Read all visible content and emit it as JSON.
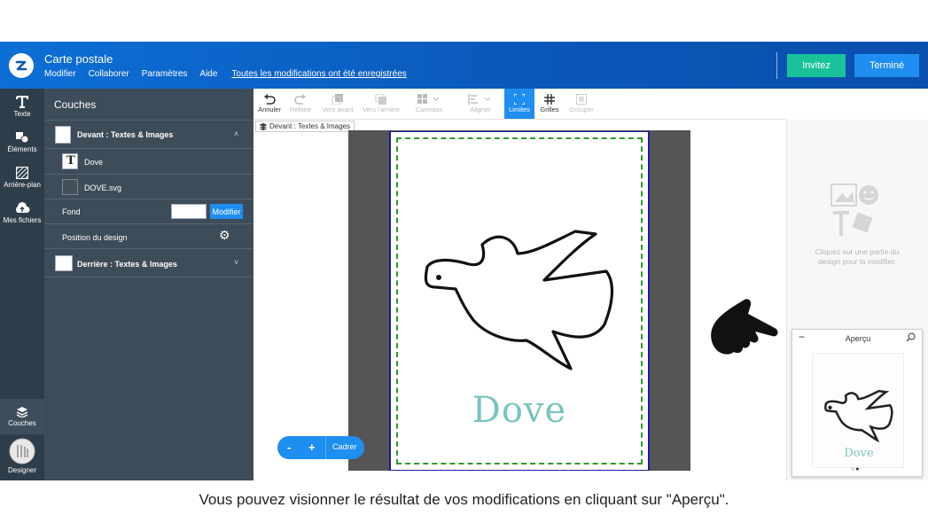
{
  "header": {
    "title": "Carte postale",
    "menu": [
      "Modifier",
      "Collaborer",
      "Paramètres",
      "Aide"
    ],
    "saved_status": "Toutes les modifications ont été enregistrées",
    "invite_label": "Invitez",
    "done_label": "Terminé"
  },
  "rail": {
    "items": [
      "Texte",
      "Éléments",
      "Arrière-plan",
      "Mes fichiers"
    ],
    "layers_label": "Couches",
    "designer_label": "Designer"
  },
  "layers": {
    "title": "Couches",
    "front_group": "Devant : Textes & Images",
    "text_layer": "Dove",
    "svg_layer": "DOVE.svg",
    "background_label": "Fond",
    "modify_label": "Modifier",
    "position_label": "Position du design",
    "back_group": "Derrière : Textes & Images"
  },
  "toolbar": {
    "tools": [
      "Annuler",
      "Refaire",
      "Vers avant",
      "Vers l'arrière",
      "Carreaux",
      "Aligner",
      "Limites",
      "Grilles",
      "Grouper"
    ]
  },
  "canvas": {
    "breadcrumb": "Devant : Textes & Images",
    "card_text": "Dove",
    "zoom_fit_label": "Cadrer",
    "zoom_minus": "-",
    "zoom_plus": "+"
  },
  "right_panel": {
    "hint": "Cliquez sur une partie du design pour la modifier.",
    "preview_title": "Aperçu",
    "preview_minimize": "−",
    "preview_card_text": "Dove"
  },
  "caption": "Vous pouvez visionner le résultat de vos modifications en cliquant sur \"Aperçu\".",
  "colors": {
    "header_blue": "#0a57b8",
    "accent_blue": "#1e8ef0",
    "invite_green": "#19c39a",
    "safe_zone_green": "#2b9a2b",
    "dove_text_teal": "#79c4bf"
  }
}
